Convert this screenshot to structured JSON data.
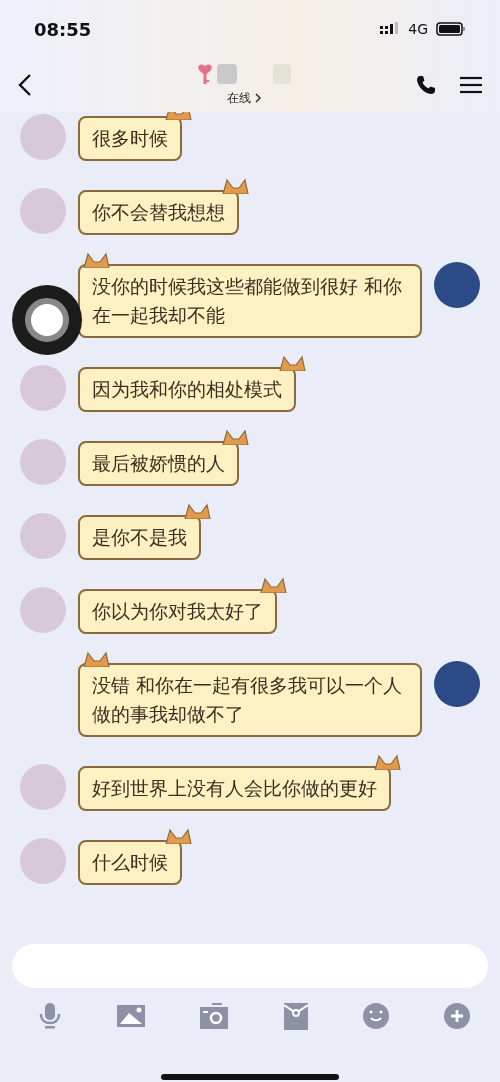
{
  "status_bar": {
    "time": "08:55",
    "network": "4G"
  },
  "header": {
    "presence": "在线"
  },
  "messages": [
    {
      "kind": "received",
      "text": "很多时候"
    },
    {
      "kind": "received",
      "text": "你不会替我想想"
    },
    {
      "kind": "sent",
      "text": "没你的时候我这些都能做到很好 和你在一起我却不能"
    },
    {
      "kind": "received",
      "text": "因为我和你的相处模式"
    },
    {
      "kind": "received",
      "text": "最后被娇惯的人"
    },
    {
      "kind": "received",
      "text": "是你不是我"
    },
    {
      "kind": "received",
      "text": "你以为你对我太好了"
    },
    {
      "kind": "sent",
      "text": "没错 和你在一起有很多我可以一个人做的事我却做不了"
    },
    {
      "kind": "received",
      "text": "好到世界上没有人会比你做的更好"
    },
    {
      "kind": "received",
      "text": "什么时候"
    }
  ]
}
